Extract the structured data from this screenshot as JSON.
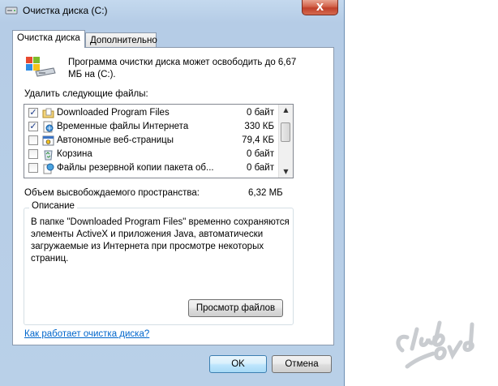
{
  "window": {
    "title": "Очистка диска  (C:)",
    "close_glyph": "X"
  },
  "tabs": [
    {
      "label": "Очистка диска",
      "active": true
    },
    {
      "label": "Дополнительно",
      "active": false
    }
  ],
  "intro": {
    "text": "Программа очистки диска может освободить до 6,67 МБ на  (C:)."
  },
  "list": {
    "label": "Удалить следующие файлы:",
    "items": [
      {
        "name": "Downloaded Program Files",
        "size": "0 байт",
        "checked": true,
        "icon": "folder-icon"
      },
      {
        "name": "Временные файлы Интернета",
        "size": "330 КБ",
        "checked": true,
        "icon": "internet-file-icon"
      },
      {
        "name": "Автономные веб-страницы",
        "size": "79,4 КБ",
        "checked": false,
        "icon": "offline-page-icon"
      },
      {
        "name": "Корзина",
        "size": "0 байт",
        "checked": false,
        "icon": "recycle-bin-icon"
      },
      {
        "name": "Файлы резервной копии пакета об...",
        "size": "0 байт",
        "checked": false,
        "icon": "backup-files-icon"
      }
    ],
    "check_glyph": "✓",
    "scroll_up": "▲",
    "scroll_down": "▼"
  },
  "freed_space": {
    "label": "Объем высвобождаемого пространства:",
    "value": "6,32 МБ"
  },
  "description": {
    "title": "Описание",
    "text": "В папке \"Downloaded Program Files\" временно сохраняются элементы ActiveX и приложения Java, автоматически загружаемые из Интернета при просмотре некоторых страниц."
  },
  "buttons": {
    "view_files": "Просмотр файлов",
    "ok": "OK",
    "cancel": "Отмена"
  },
  "link": {
    "text": "Как работает очистка диска?"
  },
  "watermark": {
    "text": "Club Sovet"
  },
  "colors": {
    "link": "#0066cc",
    "title_bar": "#c4d9ee",
    "close_button": "#c0402a"
  }
}
